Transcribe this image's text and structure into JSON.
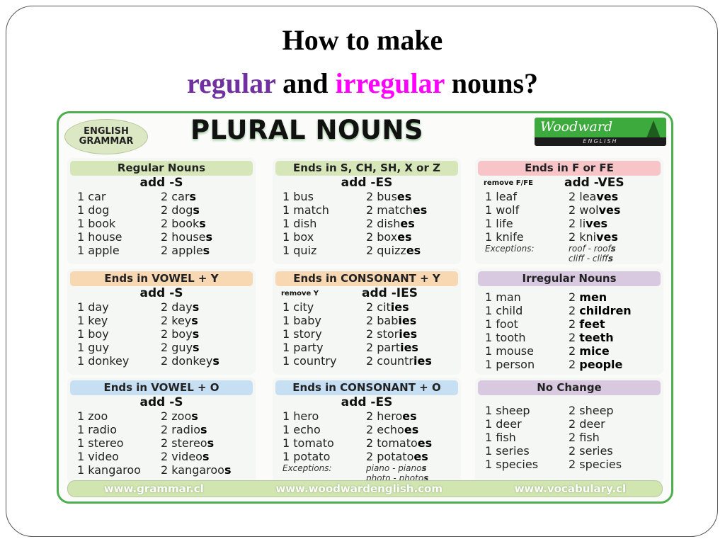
{
  "slide": {
    "title_line1": "How to make",
    "title_line2": {
      "part1": "regular",
      "part2": " and ",
      "part3": "irregular",
      "part4": " nouns?"
    }
  },
  "poster": {
    "badge": "ENGLISH GRAMMAR",
    "title": "PLURAL NOUNS",
    "logo": {
      "name": "Woodward",
      "sub": "ENGLISH"
    },
    "colors": {
      "border": "#4cae4c",
      "green": "#d6e6b9",
      "pink": "#f7c4c8",
      "orange": "#f8d7b3",
      "purple": "#d8c9e0",
      "blue": "#c6dff3"
    },
    "sections": [
      {
        "heading": "Regular Nouns",
        "note": "",
        "rule": "add -S",
        "rows": [
          {
            "s": "1 car",
            "stem": "2 car",
            "end": "s"
          },
          {
            "s": "1 dog",
            "stem": "2 dog",
            "end": "s"
          },
          {
            "s": "1 book",
            "stem": "2 book",
            "end": "s"
          },
          {
            "s": "1 house",
            "stem": "2 house",
            "end": "s"
          },
          {
            "s": "1 apple",
            "stem": "2 apple",
            "end": "s"
          }
        ]
      },
      {
        "heading": "Ends in S, CH, SH, X or Z",
        "note": "",
        "rule": "add -ES",
        "rows": [
          {
            "s": "1 bus",
            "stem": "2 bus",
            "end": "es"
          },
          {
            "s": "1 match",
            "stem": "2 match",
            "end": "es"
          },
          {
            "s": "1 dish",
            "stem": "2 dish",
            "end": "es"
          },
          {
            "s": "1 box",
            "stem": "2 box",
            "end": "es"
          },
          {
            "s": "1 quiz",
            "stem": "2 quizz",
            "end": "es"
          }
        ]
      },
      {
        "heading": "Ends in F or FE",
        "note": "remove F/FE",
        "rule": "add -VES",
        "rows": [
          {
            "s": "1 leaf",
            "stem": "2 lea",
            "end": "ves"
          },
          {
            "s": "1 wolf",
            "stem": "2 wol",
            "end": "ves"
          },
          {
            "s": "1 life",
            "stem": "2 li",
            "end": "ves"
          },
          {
            "s": "1 knife",
            "stem": "2 kni",
            "end": "ves"
          }
        ],
        "exceptions_label": "Exceptions:",
        "exceptions": [
          {
            "stem": "roof - roof",
            "end": "s"
          },
          {
            "stem": "cliff - cliff",
            "end": "s"
          }
        ]
      },
      {
        "heading": "Ends in VOWEL + Y",
        "note": "",
        "rule": "add -S",
        "rows": [
          {
            "s": "1 day",
            "stem": "2 day",
            "end": "s"
          },
          {
            "s": "1 key",
            "stem": "2 key",
            "end": "s"
          },
          {
            "s": "1 boy",
            "stem": "2 boy",
            "end": "s"
          },
          {
            "s": "1 guy",
            "stem": "2 guy",
            "end": "s"
          },
          {
            "s": "1 donkey",
            "stem": "2 donkey",
            "end": "s"
          }
        ]
      },
      {
        "heading": "Ends in CONSONANT + Y",
        "note": "remove Y",
        "rule": "add -IES",
        "rows": [
          {
            "s": "1 city",
            "stem": "2 cit",
            "end": "ies"
          },
          {
            "s": "1 baby",
            "stem": "2 bab",
            "end": "ies"
          },
          {
            "s": "1 story",
            "stem": "2 stor",
            "end": "ies"
          },
          {
            "s": "1 party",
            "stem": "2 part",
            "end": "ies"
          },
          {
            "s": "1 country",
            "stem": "2 countr",
            "end": "ies"
          }
        ]
      },
      {
        "heading": "Irregular Nouns",
        "note": "",
        "rule": "",
        "rows": [
          {
            "s": "1 man",
            "stem": "2 ",
            "end": "men"
          },
          {
            "s": "1 child",
            "stem": "2 ",
            "end": "children"
          },
          {
            "s": "1 foot",
            "stem": "2 ",
            "end": "feet"
          },
          {
            "s": "1 tooth",
            "stem": "2 ",
            "end": "teeth"
          },
          {
            "s": "1 mouse",
            "stem": "2 ",
            "end": "mice"
          },
          {
            "s": "1 person",
            "stem": "2 ",
            "end": "people"
          }
        ]
      },
      {
        "heading": "Ends in VOWEL + O",
        "note": "",
        "rule": "add -S",
        "rows": [
          {
            "s": "1 zoo",
            "stem": "2 zoo",
            "end": "s"
          },
          {
            "s": "1 radio",
            "stem": "2 radio",
            "end": "s"
          },
          {
            "s": "1 stereo",
            "stem": "2 stereo",
            "end": "s"
          },
          {
            "s": "1 video",
            "stem": "2 video",
            "end": "s"
          },
          {
            "s": "1 kangaroo",
            "stem": "2 kangaroo",
            "end": "s"
          }
        ]
      },
      {
        "heading": "Ends in CONSONANT + O",
        "note": "",
        "rule": "add -ES",
        "rows": [
          {
            "s": "1 hero",
            "stem": "2 hero",
            "end": "es"
          },
          {
            "s": "1 echo",
            "stem": "2 echo",
            "end": "es"
          },
          {
            "s": "1 tomato",
            "stem": "2 tomato",
            "end": "es"
          },
          {
            "s": "1 potato",
            "stem": "2 potato",
            "end": "es"
          }
        ],
        "exceptions_label": "Exceptions:",
        "exceptions": [
          {
            "stem": "piano - piano",
            "end": "s"
          },
          {
            "stem": "photo - photo",
            "end": "s"
          }
        ]
      },
      {
        "heading": "No Change",
        "note": "",
        "rule": "",
        "rows": [
          {
            "s": "1 sheep",
            "stem": "2 sheep",
            "end": ""
          },
          {
            "s": "1 deer",
            "stem": "2 deer",
            "end": ""
          },
          {
            "s": "1 fish",
            "stem": "2 fish",
            "end": ""
          },
          {
            "s": "1 series",
            "stem": "2 series",
            "end": ""
          },
          {
            "s": "1 species",
            "stem": "2 species",
            "end": ""
          }
        ]
      }
    ],
    "footer_links": [
      "www.grammar.cl",
      "www.woodwardenglish.com",
      "www.vocabulary.cl"
    ]
  }
}
